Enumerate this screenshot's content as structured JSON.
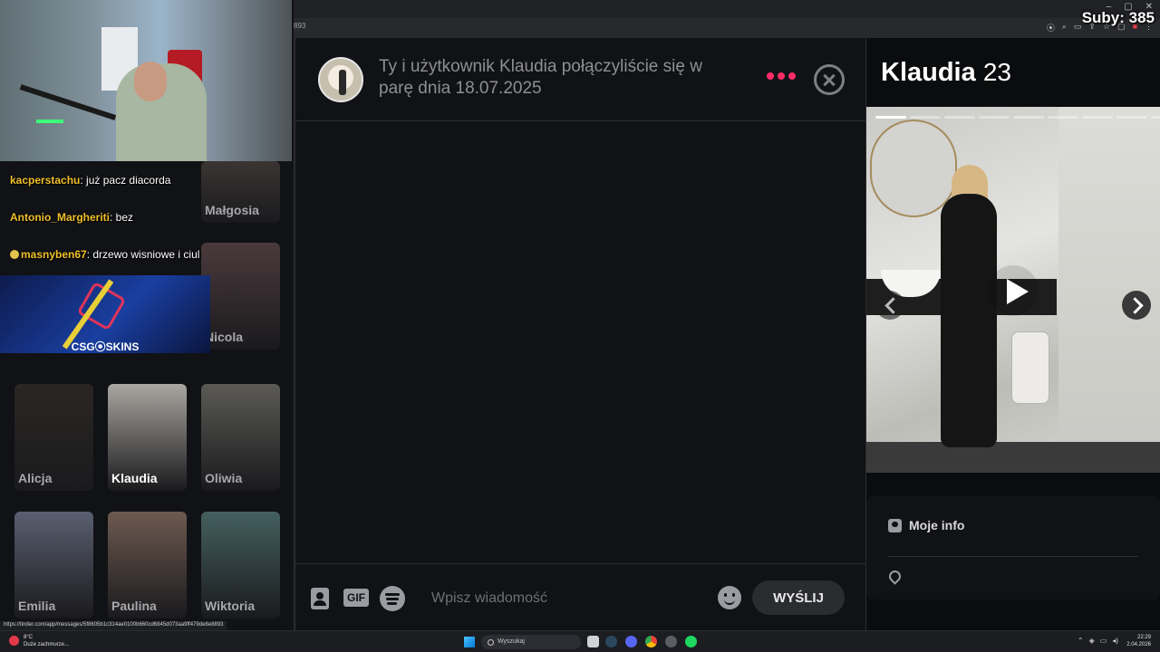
{
  "stream": {
    "subs_label": "Suby: 385"
  },
  "browser": {
    "url_fragment": "893",
    "status_url": "https://tinder.com/app/messages/5f8605b1c314ae0100b660cd6845d073aa9ff479de8e8893"
  },
  "twitch_chat": [
    {
      "user": "kacperstachu",
      "message": ": już pacz diacorda",
      "badge": false
    },
    {
      "user": "Antonio_Margheriti",
      "message": ": bez",
      "badge": false
    },
    {
      "user": "masnyben67",
      "message": ": drzewo wisniowe i ciul",
      "badge": true
    }
  ],
  "promo": {
    "logo_text": "CSG⦿SKINS"
  },
  "matches": [
    {
      "name": "Małgosia",
      "active": false,
      "tone": "#3a3532"
    },
    {
      "name": "Nicola",
      "active": false,
      "tone": "#4a3a3c"
    },
    {
      "name": "Alicja",
      "active": false,
      "tone": "#2a2623"
    },
    {
      "name": "Klaudia",
      "active": true,
      "tone": "#a9a7a1"
    },
    {
      "name": "Oliwia",
      "active": false,
      "tone": "#5b5a55"
    },
    {
      "name": "Emilia",
      "active": false,
      "tone": "#5a5f70"
    },
    {
      "name": "Paulina",
      "active": false,
      "tone": "#6d5a50"
    },
    {
      "name": "Wiktoria",
      "active": false,
      "tone": "#456060"
    }
  ],
  "chat": {
    "match_text": "Ty i użytkownik Klaudia połączyliście się w parę dnia 18.07.2025",
    "input_placeholder": "Wpisz wiadomość",
    "gif_label": "GIF",
    "send_label": "WYŚLIJ",
    "accent_color": "#fe2c67"
  },
  "profile": {
    "name": "Klaudia",
    "age": "23",
    "photo_count": 9,
    "current_photo_index": 1,
    "info_title": "Moje info"
  },
  "taskbar": {
    "weather_temp": "8°C",
    "weather_desc": "Duże zachmurze...",
    "search_label": "Wyszukaj",
    "time": "22:29",
    "date": "2.04.2026"
  }
}
